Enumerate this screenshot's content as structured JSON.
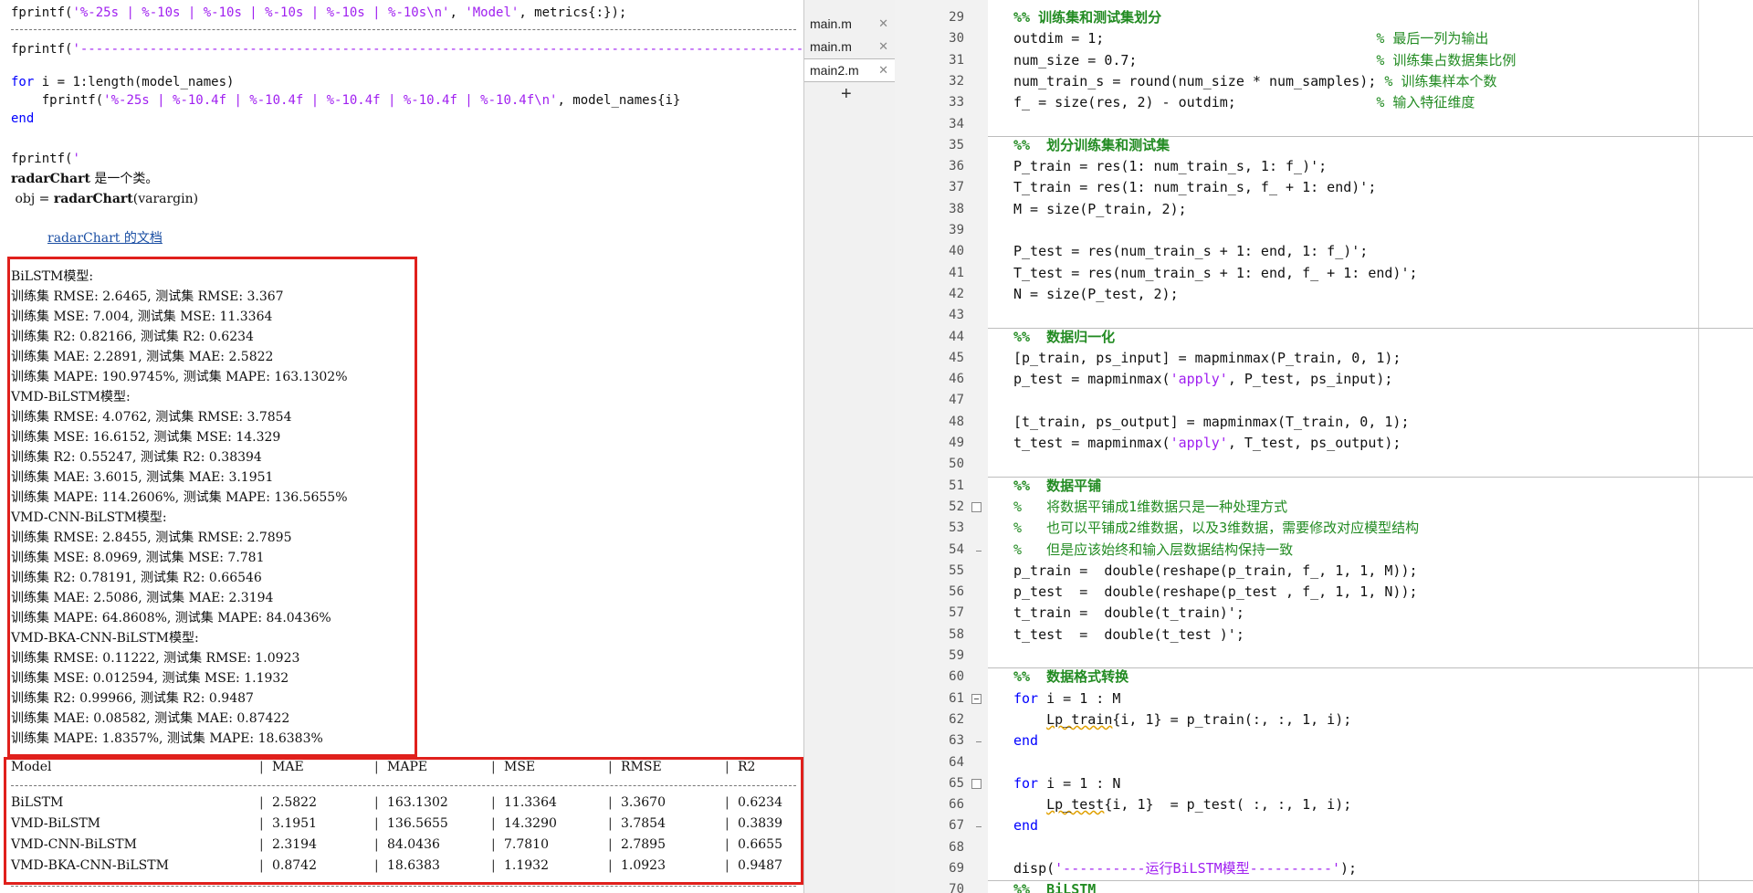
{
  "command_window": {
    "lines": [
      {
        "parts": [
          {
            "t": "fprintf("
          },
          {
            "t": "'%-25s | %-10s | %-10s | %-10s | %-10s | %-10s\\n'",
            "c": "s"
          },
          {
            "t": ", "
          },
          {
            "t": "'Model'",
            "c": "s"
          },
          {
            "t": ", metrics{:});"
          }
        ]
      },
      {
        "parts": [
          {
            "t": "fprintf("
          },
          {
            "t": "'-------------------------------------------------------------------------------------------------",
            "c": "s"
          }
        ]
      },
      {
        "parts": [
          {
            "t": "for",
            "c": "k"
          },
          {
            "t": " i = 1:length(model_names)"
          }
        ]
      },
      {
        "parts": [
          {
            "t": "    fprintf("
          },
          {
            "t": "'%-25s | %-10.4f | %-10.4f | %-10.4f | %-10.4f | %-10.4f\\n'",
            "c": "s"
          },
          {
            "t": ", model_names{i}"
          }
        ]
      },
      {
        "parts": [
          {
            "t": "end",
            "c": "k"
          }
        ]
      },
      {
        "parts": [
          {
            "t": "fprintf("
          },
          {
            "t": "'",
            "c": "s"
          }
        ]
      },
      {
        "parts": [
          {
            "t": "radarChart",
            "c": "b"
          },
          {
            "t": " 是一个类。"
          }
        ]
      },
      {
        "parts": [
          {
            "t": " obj = "
          },
          {
            "t": "radarChart",
            "c": "b"
          },
          {
            "t": "(varargin)"
          }
        ]
      }
    ],
    "doc_link": "radarChart 的文档",
    "results": [
      "BiLSTM模型:",
      "训练集 RMSE: 2.6465, 测试集 RMSE: 3.367",
      "训练集 MSE: 7.004, 测试集 MSE: 11.3364",
      "训练集 R2: 0.82166, 测试集 R2: 0.6234",
      "训练集 MAE: 2.2891, 测试集 MAE: 2.5822",
      "训练集 MAPE: 190.9745%, 测试集 MAPE: 163.1302%",
      "VMD-BiLSTM模型:",
      "训练集 RMSE: 4.0762, 测试集 RMSE: 3.7854",
      "训练集 MSE: 16.6152, 测试集 MSE: 14.329",
      "训练集 R2: 0.55247, 测试集 R2: 0.38394",
      "训练集 MAE: 3.6015, 测试集 MAE: 3.1951",
      "训练集 MAPE: 114.2606%, 测试集 MAPE: 136.5655%",
      "VMD-CNN-BiLSTM模型:",
      "训练集 RMSE: 2.8455, 测试集 RMSE: 2.7895",
      "训练集 MSE: 8.0969, 测试集 MSE: 7.781",
      "训练集 R2: 0.78191, 测试集 R2: 0.66546",
      "训练集 MAE: 2.5086, 测试集 MAE: 2.3194",
      "训练集 MAPE: 64.8608%, 测试集 MAPE: 84.0436%",
      "VMD-BKA-CNN-BiLSTM模型:",
      "训练集 RMSE: 0.11222, 测试集 RMSE: 1.0923",
      "训练集 MSE: 0.012594, 测试集 MSE: 1.1932",
      "训练集 R2: 0.99966, 测试集 R2: 0.9487",
      "训练集 MAE: 0.08582, 测试集 MAE: 0.87422",
      "训练集 MAPE: 1.8357%, 测试集 MAPE: 18.6383%"
    ],
    "table": {
      "headers": [
        "Model",
        "MAE",
        "MAPE",
        "MSE",
        "RMSE",
        "R2"
      ],
      "rows": [
        [
          "BiLSTM",
          "2.5822",
          "163.1302",
          "11.3364",
          "3.3670",
          "0.6234"
        ],
        [
          "VMD-BiLSTM",
          "3.1951",
          "136.5655",
          "14.3290",
          "3.7854",
          "0.3839"
        ],
        [
          "VMD-CNN-BiLSTM",
          "2.3194",
          "84.0436",
          "7.7810",
          "2.7895",
          "0.6655"
        ],
        [
          "VMD-BKA-CNN-BiLSTM",
          "0.8742",
          "18.6383",
          "1.1932",
          "1.0923",
          "0.9487"
        ]
      ]
    }
  },
  "file_tabs": [
    {
      "label": "main.m",
      "close": "✕",
      "active": false
    },
    {
      "label": "main.m",
      "close": "✕",
      "active": false
    },
    {
      "label": "main2.m",
      "close": "✕",
      "active": true
    }
  ],
  "new_tab_label": "+",
  "editor": {
    "lines": [
      {
        "n": "29",
        "parts": [
          {
            "t": "%% 训练集和测试集划分",
            "c": "h"
          }
        ]
      },
      {
        "n": "30",
        "parts": [
          {
            "t": "outdim = 1;                                 "
          },
          {
            "t": "% 最后一列为输出",
            "c": "c"
          }
        ]
      },
      {
        "n": "31",
        "parts": [
          {
            "t": "num_size = 0.7;                             "
          },
          {
            "t": "% 训练集占数据集比例",
            "c": "c"
          }
        ]
      },
      {
        "n": "32",
        "parts": [
          {
            "t": "num_train_s = round(num_size * num_samples); "
          },
          {
            "t": "% 训练集样本个数",
            "c": "c"
          }
        ]
      },
      {
        "n": "33",
        "parts": [
          {
            "t": "f_ = size(res, 2) - outdim;                 "
          },
          {
            "t": "% 输入特征维度",
            "c": "c"
          }
        ]
      },
      {
        "n": "34",
        "parts": []
      },
      {
        "n": "35",
        "parts": [
          {
            "t": "%%  划分训练集和测试集",
            "c": "h"
          }
        ]
      },
      {
        "n": "36",
        "parts": [
          {
            "t": "P_train = res(1: num_train_s, 1: f_)';"
          }
        ]
      },
      {
        "n": "37",
        "parts": [
          {
            "t": "T_train = res(1: num_train_s, f_ + 1: end)';"
          }
        ]
      },
      {
        "n": "38",
        "parts": [
          {
            "t": "M = size(P_train, 2);"
          }
        ]
      },
      {
        "n": "39",
        "parts": []
      },
      {
        "n": "40",
        "parts": [
          {
            "t": "P_test = res(num_train_s + 1: end, 1: f_)';"
          }
        ]
      },
      {
        "n": "41",
        "parts": [
          {
            "t": "T_test = res(num_train_s + 1: end, f_ + 1: end)';"
          }
        ]
      },
      {
        "n": "42",
        "parts": [
          {
            "t": "N = size(P_test, 2);"
          }
        ]
      },
      {
        "n": "43",
        "parts": []
      },
      {
        "n": "44",
        "parts": [
          {
            "t": "%%  数据归一化",
            "c": "h"
          }
        ]
      },
      {
        "n": "45",
        "parts": [
          {
            "t": "[p_train, ps_input] = mapminmax(P_train, 0, 1);"
          }
        ]
      },
      {
        "n": "46",
        "parts": [
          {
            "t": "p_test = mapminmax("
          },
          {
            "t": "'apply'",
            "c": "s"
          },
          {
            "t": ", P_test, ps_input);"
          }
        ]
      },
      {
        "n": "47",
        "parts": []
      },
      {
        "n": "48",
        "parts": [
          {
            "t": "[t_train, ps_output] = mapminmax(T_train, 0, 1);"
          }
        ]
      },
      {
        "n": "49",
        "parts": [
          {
            "t": "t_test = mapminmax("
          },
          {
            "t": "'apply'",
            "c": "s"
          },
          {
            "t": ", T_test, ps_output);"
          }
        ]
      },
      {
        "n": "50",
        "parts": []
      },
      {
        "n": "51",
        "parts": [
          {
            "t": "%%  数据平铺",
            "c": "h"
          }
        ]
      },
      {
        "n": "52",
        "parts": [
          {
            "t": "%   将数据平铺成1维数据只是一种处理方式",
            "c": "c"
          }
        ]
      },
      {
        "n": "53",
        "parts": [
          {
            "t": "%   也可以平铺成2维数据，以及3维数据，需要修改对应模型结构",
            "c": "c"
          }
        ]
      },
      {
        "n": "54",
        "parts": [
          {
            "t": "%   但是应该始终和输入层数据结构保持一致",
            "c": "c"
          }
        ]
      },
      {
        "n": "55",
        "parts": [
          {
            "t": "p_train =  double(reshape(p_train, f_, 1, 1, M));"
          }
        ]
      },
      {
        "n": "56",
        "parts": [
          {
            "t": "p_test  =  double(reshape(p_test , f_, 1, 1, N));"
          }
        ]
      },
      {
        "n": "57",
        "parts": [
          {
            "t": "t_train =  double(t_train)';"
          }
        ]
      },
      {
        "n": "58",
        "parts": [
          {
            "t": "t_test  =  double(t_test )';"
          }
        ]
      },
      {
        "n": "59",
        "parts": []
      },
      {
        "n": "60",
        "parts": [
          {
            "t": "%%  数据格式转换",
            "c": "h"
          }
        ]
      },
      {
        "n": "61",
        "parts": [
          {
            "t": "for",
            "c": "k"
          },
          {
            "t": " i = 1 : M"
          }
        ]
      },
      {
        "n": "62",
        "parts": [
          {
            "t": "    "
          },
          {
            "t": "Lp_train",
            "c": "u"
          },
          {
            "t": "{i, 1} = p_train(:, :, 1, i);"
          }
        ]
      },
      {
        "n": "63",
        "parts": [
          {
            "t": "end",
            "c": "k"
          }
        ]
      },
      {
        "n": "64",
        "parts": []
      },
      {
        "n": "65",
        "parts": [
          {
            "t": "for",
            "c": "k"
          },
          {
            "t": " i = 1 : N"
          }
        ]
      },
      {
        "n": "66",
        "parts": [
          {
            "t": "    "
          },
          {
            "t": "Lp_test",
            "c": "u"
          },
          {
            "t": "{i, 1}  = p_test( :, :, 1, i);"
          }
        ]
      },
      {
        "n": "67",
        "parts": [
          {
            "t": "end",
            "c": "k"
          }
        ]
      },
      {
        "n": "68",
        "parts": []
      },
      {
        "n": "69",
        "parts": [
          {
            "t": "disp("
          },
          {
            "t": "'----------运行BiLSTM模型----------'",
            "c": "s"
          },
          {
            "t": ");"
          }
        ]
      },
      {
        "n": "70",
        "parts": [
          {
            "t": "%%  BiLSTM",
            "c": "h"
          }
        ]
      }
    ]
  }
}
